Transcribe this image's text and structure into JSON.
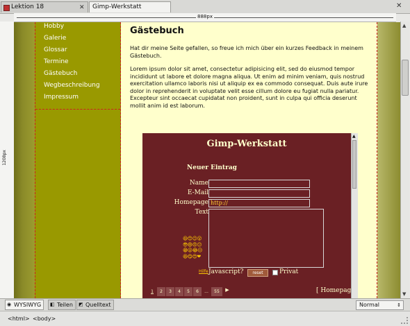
{
  "tabs": [
    {
      "label": "Lektion 18",
      "active": false
    },
    {
      "label": "Gimp-Werkstatt",
      "active": true
    }
  ],
  "ruler": {
    "width_label": "888px",
    "height_label": "1208px"
  },
  "sidebar": {
    "items": [
      {
        "label": "Hobby"
      },
      {
        "label": "Galerie"
      },
      {
        "label": "Glossar"
      },
      {
        "label": "Termine"
      },
      {
        "label": "Gästebuch"
      },
      {
        "label": "Wegbeschreibung"
      },
      {
        "label": "Impressum"
      }
    ]
  },
  "content": {
    "heading": "Gästebuch",
    "intro": "Hat dir meine Seite gefallen, so freue ich mich über ein kurzes Feedback in meinem Gästebuch.",
    "lorem": "Lorem ipsum dolor sit amet, consectetur adipisicing elit, sed do eiusmod tempor incididunt ut labore et dolore magna aliqua. Ut enim ad minim veniam, quis nostrud exercitation ullamco laboris nisi ut aliquip ex ea commodo consequat. Duis aute irure dolor in reprehenderit in voluptate velit esse cillum dolore eu fugiat nulla pariatur. Excepteur sint occaecat cupidatat non proident, sunt in culpa qui officia deserunt mollit anim id est laborum."
  },
  "guestbook": {
    "title": "Gimp-Werkstatt",
    "new_entry": "Neuer Eintrag",
    "name_label": "Name:",
    "email_label": "E-Mail:",
    "homepage_label": "Homepage:",
    "homepage_value": "http://",
    "text_label": "Text:",
    "smileys": "😃😊😉😮\n😎😄😠😕\n😁😜😂😐\n😆😋😍❤",
    "help_link": "Hilfe",
    "javascript_label": "Javascript?",
    "reset_button": "reset",
    "private_label": "Privat",
    "pages": [
      "1",
      "2",
      "3",
      "4",
      "5",
      "6",
      "...",
      "55"
    ],
    "next_arrow": "▶",
    "homepage_link": "[ Homepag"
  },
  "view_tabs": [
    {
      "label": "WYSIWYG",
      "icon": "eye-icon",
      "selected": true
    },
    {
      "label": "Teilen",
      "icon": "split-icon",
      "selected": false
    },
    {
      "label": "Quelltext",
      "icon": "code-icon",
      "selected": false
    }
  ],
  "format_select": {
    "value": "Normal"
  },
  "status": {
    "crumbs": [
      "<html>",
      "<body>"
    ]
  },
  "colors": {
    "sidebar_bg": "#999900",
    "content_bg": "#ffffcc",
    "guestbook_bg": "#6a2024",
    "guides": "#cc2222"
  }
}
